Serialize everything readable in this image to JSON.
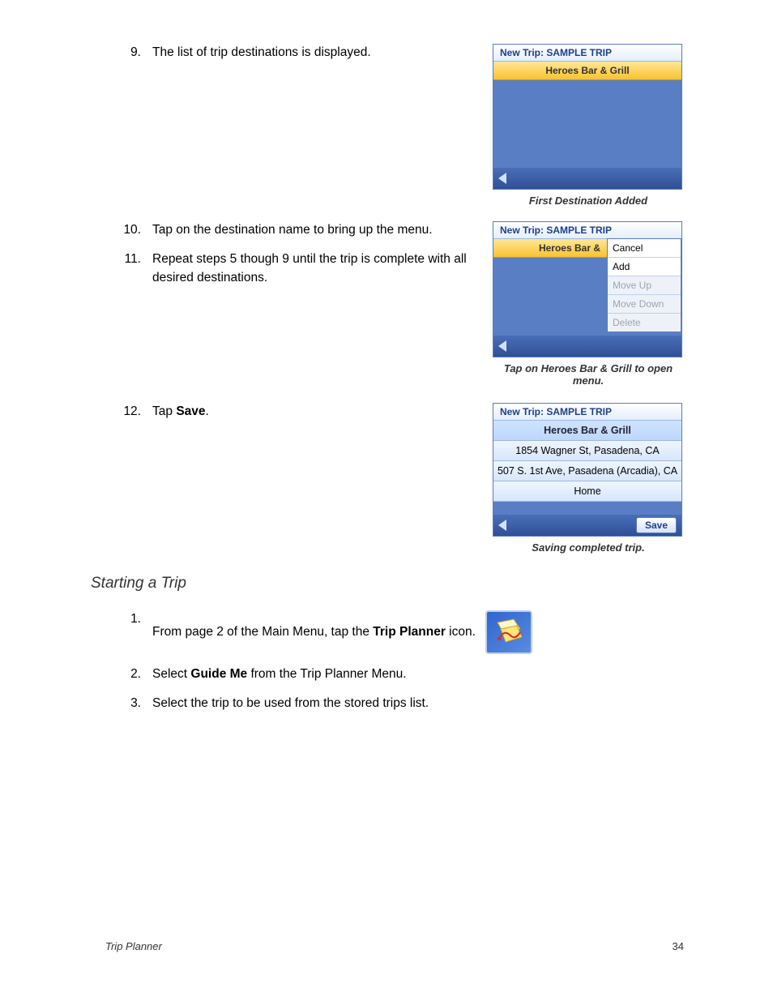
{
  "steps_a": [
    {
      "n": "9.",
      "t": "The list of trip destinations is displayed."
    }
  ],
  "steps_b": [
    {
      "n": "10.",
      "t": "Tap on the destination name to bring up the menu."
    },
    {
      "n": "11.",
      "t": "Repeat steps 5 though 9 until the trip is complete with all desired destinations."
    }
  ],
  "steps_c": [
    {
      "n": "12.",
      "pre": "Tap ",
      "bold": "Save",
      "post": "."
    }
  ],
  "section_title": "Starting a Trip",
  "start_steps": [
    {
      "n": "1.",
      "pre": "From page 2 of the Main Menu, tap the ",
      "bold": "Trip Planner",
      "post": " icon."
    },
    {
      "n": "2.",
      "pre": "Select ",
      "bold": "Guide Me",
      "post": " from the Trip Planner Menu."
    },
    {
      "n": "3.",
      "pre": "Select the trip to be used from the stored trips list.",
      "bold": "",
      "post": ""
    }
  ],
  "dev1": {
    "title": "New Trip: SAMPLE TRIP",
    "row": "Heroes Bar & Grill",
    "caption": "First Destination Added"
  },
  "dev2": {
    "title": "New Trip: SAMPLE TRIP",
    "row": "Heroes Bar &",
    "menu": [
      "Cancel",
      "Add",
      "Move Up",
      "Move Down",
      "Delete"
    ],
    "caption": "Tap on Heroes Bar & Grill to open menu."
  },
  "dev3": {
    "title": "New Trip: SAMPLE TRIP",
    "items": [
      "Heroes Bar & Grill",
      "1854 Wagner St, Pasadena, CA",
      "507 S. 1st Ave, Pasadena (Arcadia), CA",
      "Home"
    ],
    "save": "Save",
    "caption": "Saving completed trip."
  },
  "footer": {
    "left": "Trip Planner",
    "page": "34"
  }
}
